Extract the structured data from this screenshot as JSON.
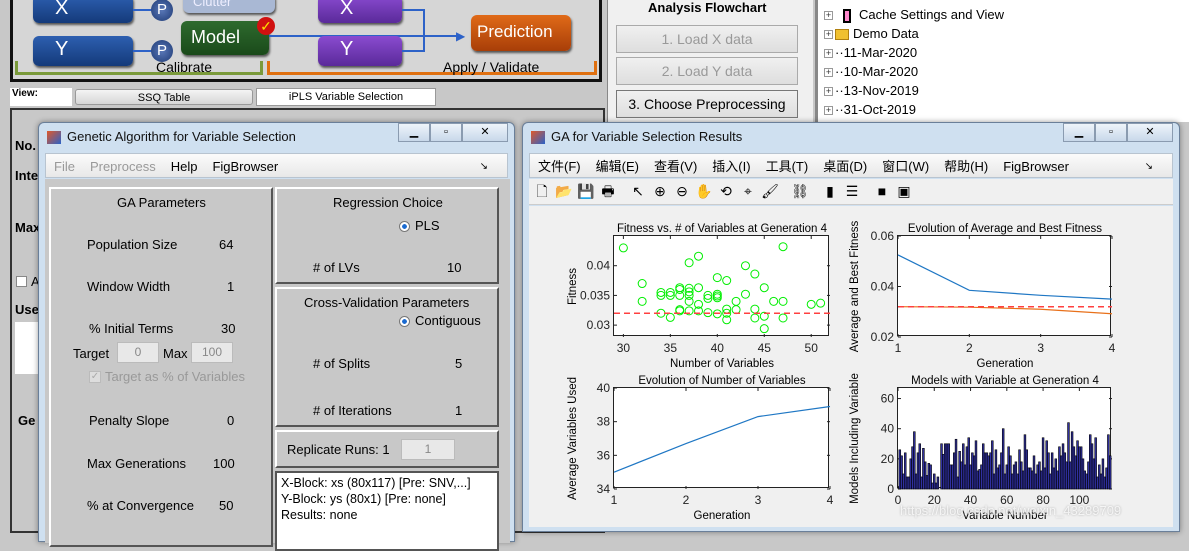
{
  "flowchart": {
    "x_label": "X",
    "y_label": "Y",
    "clutter": "Clutter",
    "model": "Model",
    "prediction": "Prediction",
    "p_label": "P",
    "calibrate": "Calibrate",
    "apply": "Apply / Validate"
  },
  "view": {
    "label": "View:",
    "ssq": "SSQ Table",
    "ipls": "iPLS Variable Selection"
  },
  "analysis": {
    "title": "Analysis Flowchart",
    "buttons": [
      "1. Load X data",
      "2. Load Y data",
      "3. Choose Preprocessing"
    ]
  },
  "tree": {
    "items": [
      "Cache Settings and View",
      "Demo Data",
      "11-Mar-2020",
      "10-Mar-2020",
      "13-Nov-2019",
      "31-Oct-2019"
    ]
  },
  "background_labels": [
    "No.",
    "Inte",
    "Max",
    "A",
    "Use",
    "Ge"
  ],
  "ga_window": {
    "title": "Genetic Algorithm for Variable Selection",
    "menu": [
      "File",
      "Preprocess",
      "Help",
      "FigBrowser"
    ],
    "params": {
      "title": "GA Parameters",
      "rows": [
        {
          "label": "Population Size",
          "value": "64"
        },
        {
          "label": "Window Width",
          "value": "1"
        },
        {
          "label": "% Initial Terms",
          "value": "30"
        },
        {
          "label": "Penalty Slope",
          "value": "0"
        },
        {
          "label": "Max Generations",
          "value": "100"
        },
        {
          "label": "% at Convergence",
          "value": "50"
        }
      ],
      "target_label": "Target",
      "target_value": "0",
      "max_label": "Max",
      "max_value": "100",
      "target_pct": "Target as % of Variables"
    },
    "regression": {
      "title": "Regression Choice",
      "option": "PLS",
      "lvs_label": "# of LVs",
      "lvs_value": "10"
    },
    "cv": {
      "title": "Cross-Validation Parameters",
      "option": "Contiguous",
      "splits_label": "# of Splits",
      "splits_value": "5",
      "iter_label": "# of Iterations",
      "iter_value": "1"
    },
    "replicate": {
      "label": "Replicate Runs: 1",
      "value": "1"
    },
    "info": [
      "X-Block: xs (80x117) [Pre: SNV,...]",
      "Y-Block: ys (80x1) [Pre: none]",
      "Results: none"
    ]
  },
  "results_window": {
    "title": "GA for Variable Selection Results",
    "menu": [
      "文件(F)",
      "编辑(E)",
      "查看(V)",
      "插入(I)",
      "工具(T)",
      "桌面(D)",
      "窗口(W)",
      "帮助(H)",
      "FigBrowser"
    ],
    "toolbar": [
      "new-icon",
      "open-icon",
      "save-icon",
      "print-icon",
      "pointer-icon",
      "zoom-in-icon",
      "zoom-out-icon",
      "pan-icon",
      "rotate-icon",
      "data-cursor-icon",
      "brush-icon",
      "link-icon",
      "colorbar-icon",
      "legend-icon",
      "hide-plot-tools-icon",
      "show-plot-tools-icon"
    ]
  },
  "watermark": "https://blog.csdn.net/weixin_43289709",
  "chart_data": [
    {
      "type": "scatter",
      "title": "Fitness vs. # of Variables at Generation 4",
      "xlabel": "Number of Variables",
      "ylabel": "Fitness",
      "xlim": [
        29,
        52
      ],
      "ylim": [
        0.028,
        0.045
      ],
      "xticks": [
        30,
        35,
        40,
        45,
        50
      ],
      "yticks": [
        0.03,
        0.035,
        0.04
      ],
      "ytick_labels": [
        "0.03",
        "0.035",
        "0.04"
      ],
      "marker_color": "#00ee00",
      "reference_line": {
        "y": 0.032,
        "style": "dashed",
        "color": "#ff4040"
      },
      "points": [
        [
          30,
          0.043
        ],
        [
          32,
          0.037
        ],
        [
          32,
          0.034
        ],
        [
          34,
          0.0355
        ],
        [
          34,
          0.035
        ],
        [
          34,
          0.032
        ],
        [
          35,
          0.0355
        ],
        [
          35,
          0.035
        ],
        [
          35,
          0.0313
        ],
        [
          36,
          0.0363
        ],
        [
          36,
          0.036
        ],
        [
          36,
          0.035
        ],
        [
          36,
          0.0326
        ],
        [
          36,
          0.0324
        ],
        [
          37,
          0.0405
        ],
        [
          37,
          0.0362
        ],
        [
          37,
          0.0356
        ],
        [
          37,
          0.035
        ],
        [
          37,
          0.034
        ],
        [
          37,
          0.0324
        ],
        [
          38,
          0.0416
        ],
        [
          38,
          0.0363
        ],
        [
          38,
          0.0335
        ],
        [
          38,
          0.0324
        ],
        [
          39,
          0.035
        ],
        [
          39,
          0.0345
        ],
        [
          39,
          0.0321
        ],
        [
          40,
          0.038
        ],
        [
          40,
          0.0352
        ],
        [
          40,
          0.0346
        ],
        [
          40,
          0.0349
        ],
        [
          40,
          0.0319
        ],
        [
          41,
          0.0375
        ],
        [
          41,
          0.0327
        ],
        [
          41,
          0.032
        ],
        [
          41,
          0.0309
        ],
        [
          42,
          0.034
        ],
        [
          42,
          0.0326
        ],
        [
          43,
          0.04
        ],
        [
          43,
          0.0352
        ],
        [
          44,
          0.0386
        ],
        [
          44,
          0.0327
        ],
        [
          44,
          0.0312
        ],
        [
          45,
          0.0363
        ],
        [
          45,
          0.0315
        ],
        [
          45,
          0.0294
        ],
        [
          46,
          0.034
        ],
        [
          47,
          0.0432
        ],
        [
          47,
          0.034
        ],
        [
          47,
          0.0312
        ],
        [
          50,
          0.0335
        ],
        [
          51,
          0.0337
        ]
      ]
    },
    {
      "type": "line",
      "title": "Evolution of Average and Best Fitness",
      "xlabel": "Generation",
      "ylabel": "Average and Best Fitness",
      "xlim": [
        1,
        4
      ],
      "ylim": [
        0.02,
        0.06
      ],
      "xticks": [
        1,
        2,
        3,
        4
      ],
      "yticks": [
        0.02,
        0.04,
        0.06
      ],
      "ytick_labels": [
        "0.02",
        "0.04",
        "0.06"
      ],
      "x": [
        1,
        2,
        3,
        4
      ],
      "series": [
        {
          "values": [
            0.0525,
            0.0385,
            0.0365,
            0.035
          ],
          "color": "#1f77c4"
        },
        {
          "values": [
            0.032,
            0.0318,
            0.031,
            0.0292
          ],
          "color": "#e8701a"
        }
      ],
      "reference_line": {
        "y": 0.032,
        "style": "dashed",
        "color": "#ff4040"
      }
    },
    {
      "type": "line",
      "title": "Evolution of Number of Variables",
      "xlabel": "Generation",
      "ylabel": "Average Variables Used",
      "xlim": [
        1,
        4
      ],
      "ylim": [
        34,
        40
      ],
      "xticks": [
        1,
        2,
        3,
        4
      ],
      "yticks": [
        34,
        36,
        38,
        40
      ],
      "ytick_labels": [
        "34",
        "36",
        "38",
        "40"
      ],
      "x": [
        1,
        2,
        3,
        4
      ],
      "series": [
        {
          "values": [
            35,
            36.7,
            38.3,
            38.9
          ],
          "color": "#1f77c4"
        }
      ]
    },
    {
      "type": "bar",
      "title": "Models with Variable at Generation 4",
      "xlabel": "Variable Number",
      "ylabel": "Models Including Variable",
      "xlim": [
        0,
        118
      ],
      "ylim": [
        0,
        67
      ],
      "xticks": [
        0,
        20,
        40,
        60,
        80,
        100
      ],
      "yticks": [
        0,
        20,
        40,
        60
      ],
      "ytick_labels": [
        "0",
        "20",
        "40",
        "60"
      ],
      "bar_color": "#3030a0",
      "values": [
        26,
        22,
        10,
        24,
        8,
        8,
        20,
        28,
        38,
        10,
        24,
        30,
        8,
        27,
        18,
        9,
        17,
        16,
        4,
        10,
        4,
        8,
        0,
        30,
        23,
        30,
        30,
        30,
        16,
        16,
        24,
        33,
        8,
        25,
        18,
        30,
        16,
        28,
        34,
        16,
        24,
        22,
        32,
        12,
        13,
        16,
        30,
        24,
        24,
        22,
        24,
        32,
        10,
        26,
        14,
        16,
        24,
        40,
        10,
        16,
        28,
        22,
        10,
        16,
        18,
        10,
        26,
        18,
        12,
        36,
        26,
        14,
        14,
        12,
        22,
        10,
        16,
        18,
        12,
        34,
        14,
        32,
        24,
        10,
        24,
        14,
        20,
        12,
        28,
        22,
        30,
        24,
        18,
        44,
        18,
        38,
        28,
        22,
        32,
        28,
        28,
        20,
        12,
        10,
        18,
        36,
        30,
        20,
        34,
        8,
        16,
        10,
        20,
        8,
        14,
        36,
        22
      ]
    }
  ]
}
